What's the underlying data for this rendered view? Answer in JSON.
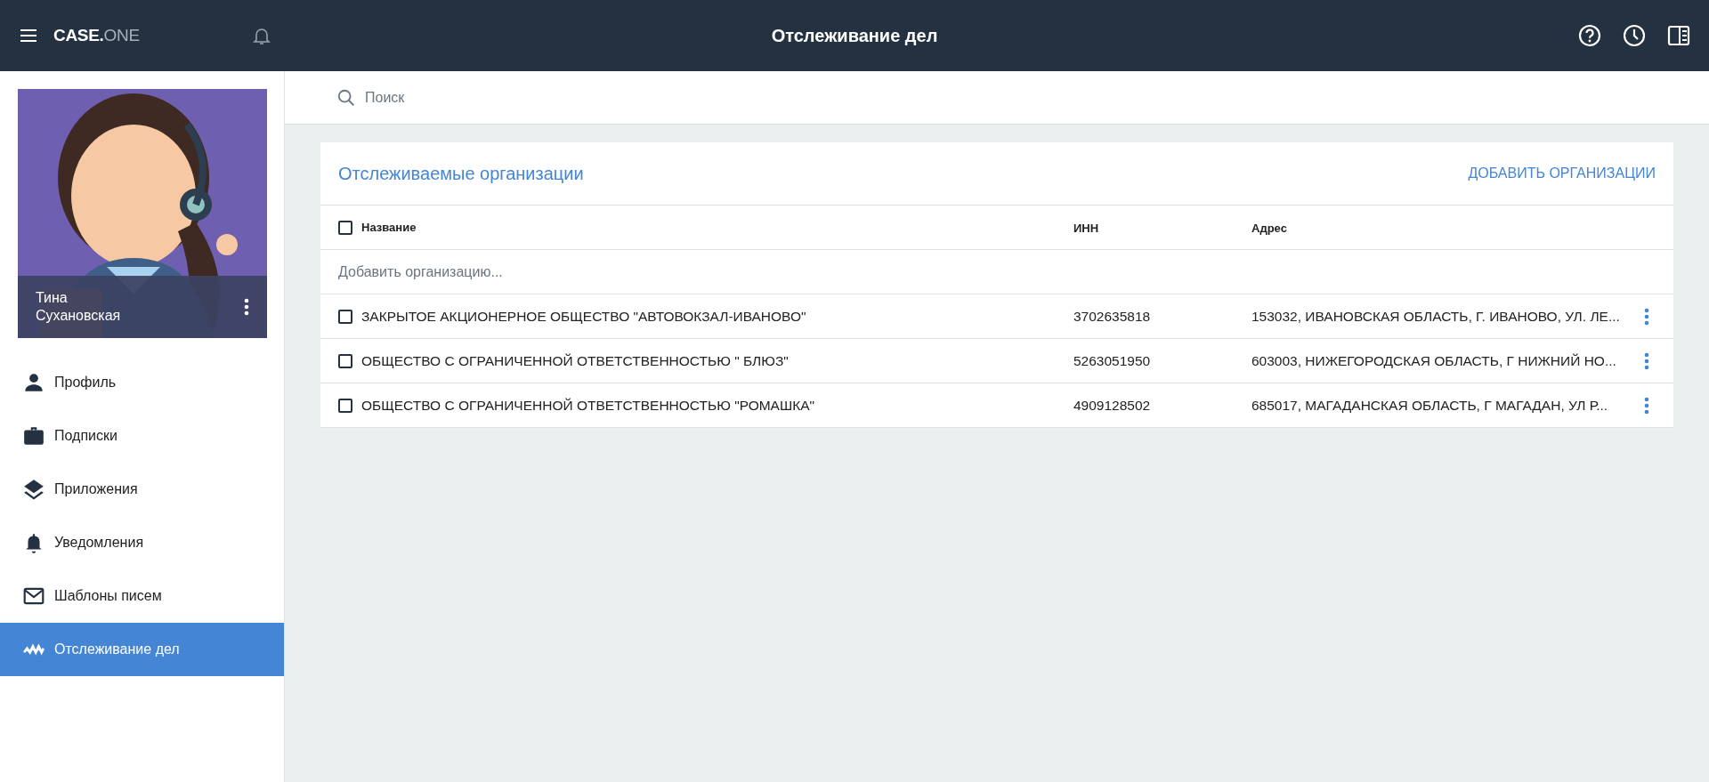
{
  "header": {
    "logo_main": "CASE.",
    "logo_sub": "ONE",
    "title": "Отслеживание дел"
  },
  "profile": {
    "first_name": "Тина",
    "last_name": "Сухановская"
  },
  "sidebar": {
    "items": [
      {
        "label": "Профиль",
        "kind": "person",
        "selected": false
      },
      {
        "label": "Подписки",
        "kind": "briefcase",
        "selected": false
      },
      {
        "label": "Приложения",
        "kind": "layers",
        "selected": false
      },
      {
        "label": "Уведомления",
        "kind": "bell",
        "selected": false
      },
      {
        "label": "Шаблоны писем",
        "kind": "mail",
        "selected": false
      },
      {
        "label": "Отслеживание дел",
        "kind": "pulse",
        "selected": true
      }
    ]
  },
  "search": {
    "placeholder": "Поиск"
  },
  "card": {
    "title": "Отслеживаемые организации",
    "action": "ДОБАВИТЬ ОРГАНИЗАЦИИ",
    "select_all": {
      "checked": false
    },
    "columns": [
      "Название",
      "ИНН",
      "Адрес"
    ],
    "add_placeholder": "Добавить организацию...",
    "rows": [
      {
        "checked": false,
        "name": "ЗАКРЫТОЕ АКЦИОНЕРНОЕ ОБЩЕСТВО \"АВТОВОКЗАЛ-ИВАНОВО\"",
        "inn": "3702635818",
        "address": "153032, ИВАНОВСКАЯ ОБЛАСТЬ, Г. ИВАНОВО, УЛ. ЛЕ..."
      },
      {
        "checked": false,
        "name": "ОБЩЕСТВО С ОГРАНИЧЕННОЙ ОТВЕТСТВЕННОСТЬЮ \" БЛЮЗ\"",
        "inn": "5263051950",
        "address": "603003, НИЖЕГОРОДСКАЯ ОБЛАСТЬ, Г НИЖНИЙ НО..."
      },
      {
        "checked": false,
        "name": "ОБЩЕСТВО С ОГРАНИЧЕННОЙ ОТВЕТСТВЕННОСТЬЮ \"РОМАШКА\"",
        "inn": "4909128502",
        "address": "685017, МАГАДАНСКАЯ ОБЛАСТЬ, Г МАГАДАН, УЛ Р..."
      }
    ]
  }
}
